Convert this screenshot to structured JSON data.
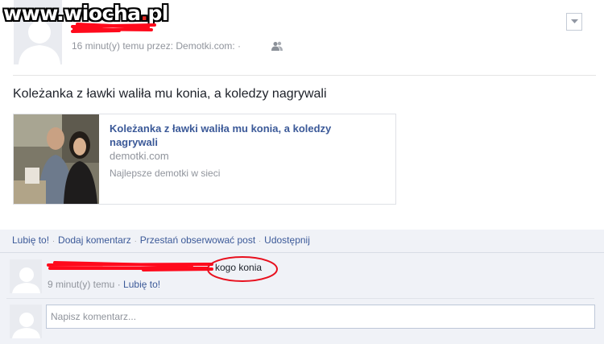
{
  "watermark": {
    "site": "www.wiocha",
    "dot": ".",
    "tld": "pl"
  },
  "post": {
    "meta": "16 minut(y) temu przez: Demotki.com: ·",
    "friends_icon": "friends-icon",
    "dropdown_icon": "chevron-down-icon",
    "text": "Koleżanka z ławki waliła mu konia, a koledzy nagrywali"
  },
  "link_card": {
    "title": "Koleżanka z ławki waliła mu konia, a koledzy nagrywali",
    "domain": "demotki.com",
    "description": "Najlepsze demotki w sieci"
  },
  "actions": {
    "like": "Lubię to!",
    "comment": "Dodaj komentarz",
    "unfollow": "Przestań obserwować post",
    "share": "Udostępnij",
    "separator": "·"
  },
  "comment": {
    "text": "kogo konia",
    "time": "9 minut(y) temu",
    "separator": "·",
    "like": "Lubię to!"
  },
  "write_comment": {
    "placeholder": "Napisz komentarz..."
  },
  "colors": {
    "link": "#3b5998",
    "meta": "#90949c",
    "action_bg": "#f0f2f7",
    "scribble": "#ff0a1c"
  }
}
